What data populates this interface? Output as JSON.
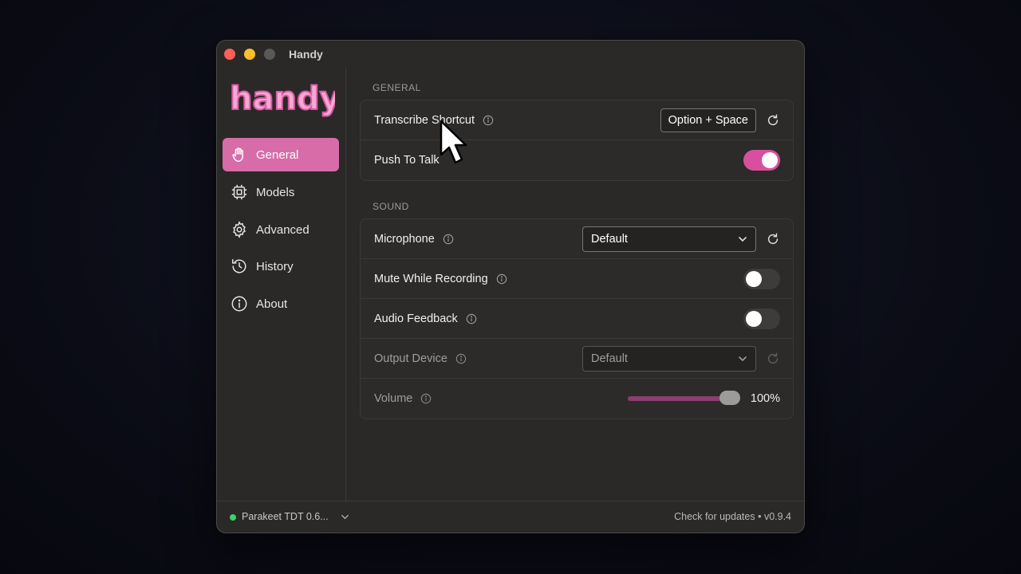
{
  "window": {
    "title": "Handy"
  },
  "sidebar": {
    "logo_text": "handy",
    "items": [
      {
        "label": "General",
        "icon": "hand-icon",
        "active": true
      },
      {
        "label": "Models",
        "icon": "chip-icon"
      },
      {
        "label": "Advanced",
        "icon": "gear-icon"
      },
      {
        "label": "History",
        "icon": "history-icon"
      },
      {
        "label": "About",
        "icon": "info-icon"
      }
    ]
  },
  "general": {
    "section_label": "GENERAL",
    "transcribe_shortcut": {
      "label": "Transcribe Shortcut",
      "value": "Option + Space"
    },
    "push_to_talk": {
      "label": "Push To Talk",
      "enabled": true
    }
  },
  "sound": {
    "section_label": "SOUND",
    "microphone": {
      "label": "Microphone",
      "value": "Default"
    },
    "mute_while_recording": {
      "label": "Mute While Recording",
      "enabled": false
    },
    "audio_feedback": {
      "label": "Audio Feedback",
      "enabled": false
    },
    "output_device": {
      "label": "Output Device",
      "value": "Default"
    },
    "volume": {
      "label": "Volume",
      "value": "100%",
      "fraction": 1.0
    }
  },
  "footer": {
    "model_name": "Parakeet TDT 0.6...",
    "update_text": "Check for updates",
    "separator": "•",
    "version": "v0.9.4"
  },
  "colors": {
    "accent": "#d76ca9",
    "toggle_on": "#d94fa0",
    "status_ok": "#38d46a"
  }
}
